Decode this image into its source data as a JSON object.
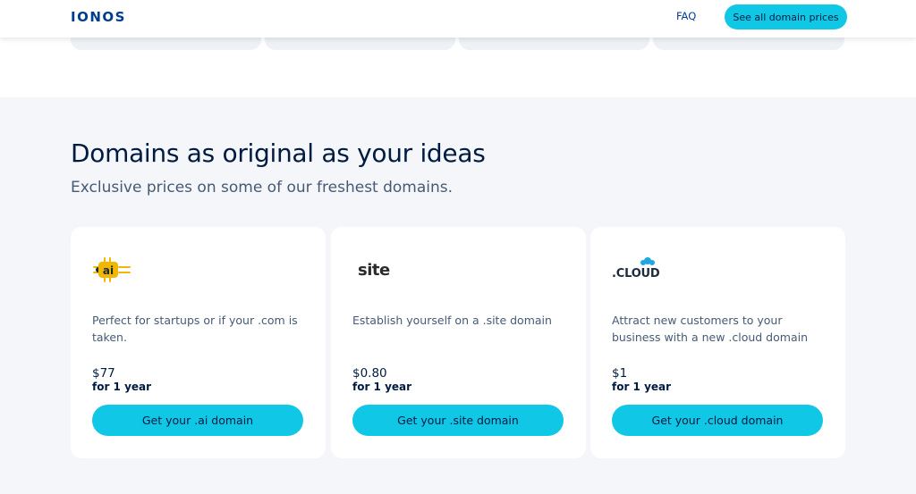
{
  "header": {
    "logo": "IONOS",
    "faq": "FAQ",
    "cta": "See all domain prices"
  },
  "section": {
    "title": "Domains as original as your ideas",
    "subtitle": "Exclusive prices on some of our freshest domains."
  },
  "cards": [
    {
      "tld": ".ai",
      "logo_icon": "ai-logo-icon",
      "logo_text": "ai",
      "description": "Perfect for startups or if your .com is taken.",
      "price": "$77",
      "period": "for 1 year",
      "button": "Get your .ai domain"
    },
    {
      "tld": ".site",
      "logo_icon": "site-logo-icon",
      "logo_text": "site",
      "description": "Establish yourself on a .site domain",
      "price": "$0.80",
      "period": "for 1 year",
      "button": "Get your .site domain"
    },
    {
      "tld": ".cloud",
      "logo_icon": "cloud-logo-icon",
      "logo_text": ".CLOUD",
      "description": "Attract new customers to your business with a new .cloud domain",
      "price": "$1",
      "period": "for 1 year",
      "button": "Get your .cloud domain"
    }
  ],
  "colors": {
    "brand": "#003d8f",
    "accent": "#11c7e6",
    "text": "#001b41",
    "muted": "#465a75",
    "section_bg": "#f4f6f9"
  }
}
